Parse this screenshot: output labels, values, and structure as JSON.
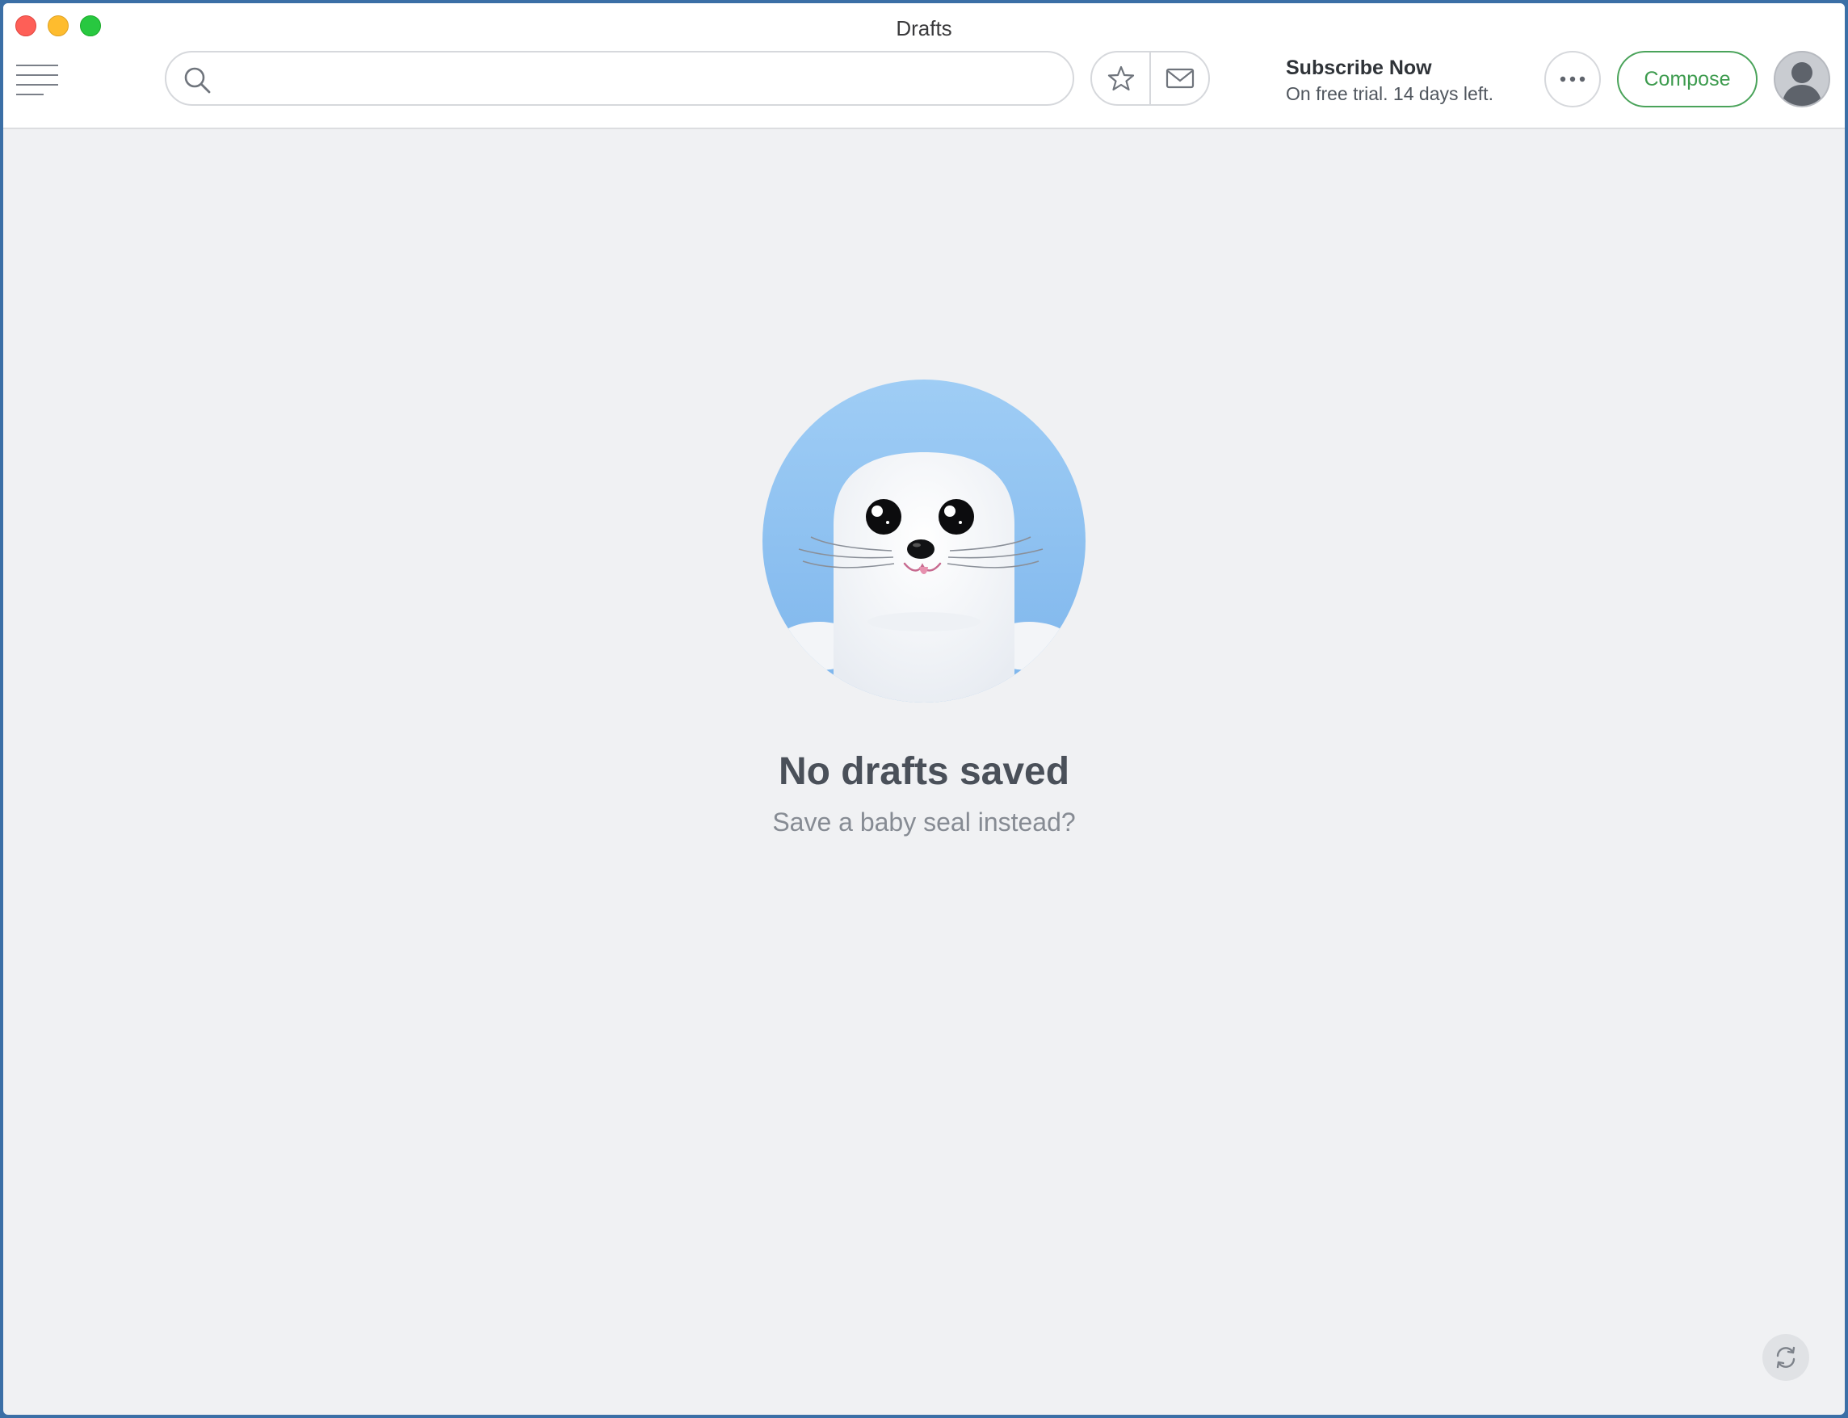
{
  "window": {
    "title": "Drafts"
  },
  "toolbar": {
    "menu_icon": "hamburger-icon",
    "search": {
      "placeholder": "",
      "value": ""
    },
    "starred_icon": "star-icon",
    "mail_icon": "envelope-icon",
    "subscribe": {
      "title": "Subscribe Now",
      "subtitle": "On free trial. 14 days left."
    },
    "more_icon": "ellipsis-icon",
    "compose_label": "Compose",
    "avatar_icon": "user-avatar-icon"
  },
  "empty_state": {
    "illustration": "baby-seal",
    "title": "No drafts saved",
    "subtitle": "Save a baby seal instead?"
  },
  "footer": {
    "refresh_icon": "refresh-icon"
  },
  "colors": {
    "accent_green": "#4aa35a",
    "illustration_blue": "#8ec3f2",
    "background": "#f0f1f3"
  }
}
